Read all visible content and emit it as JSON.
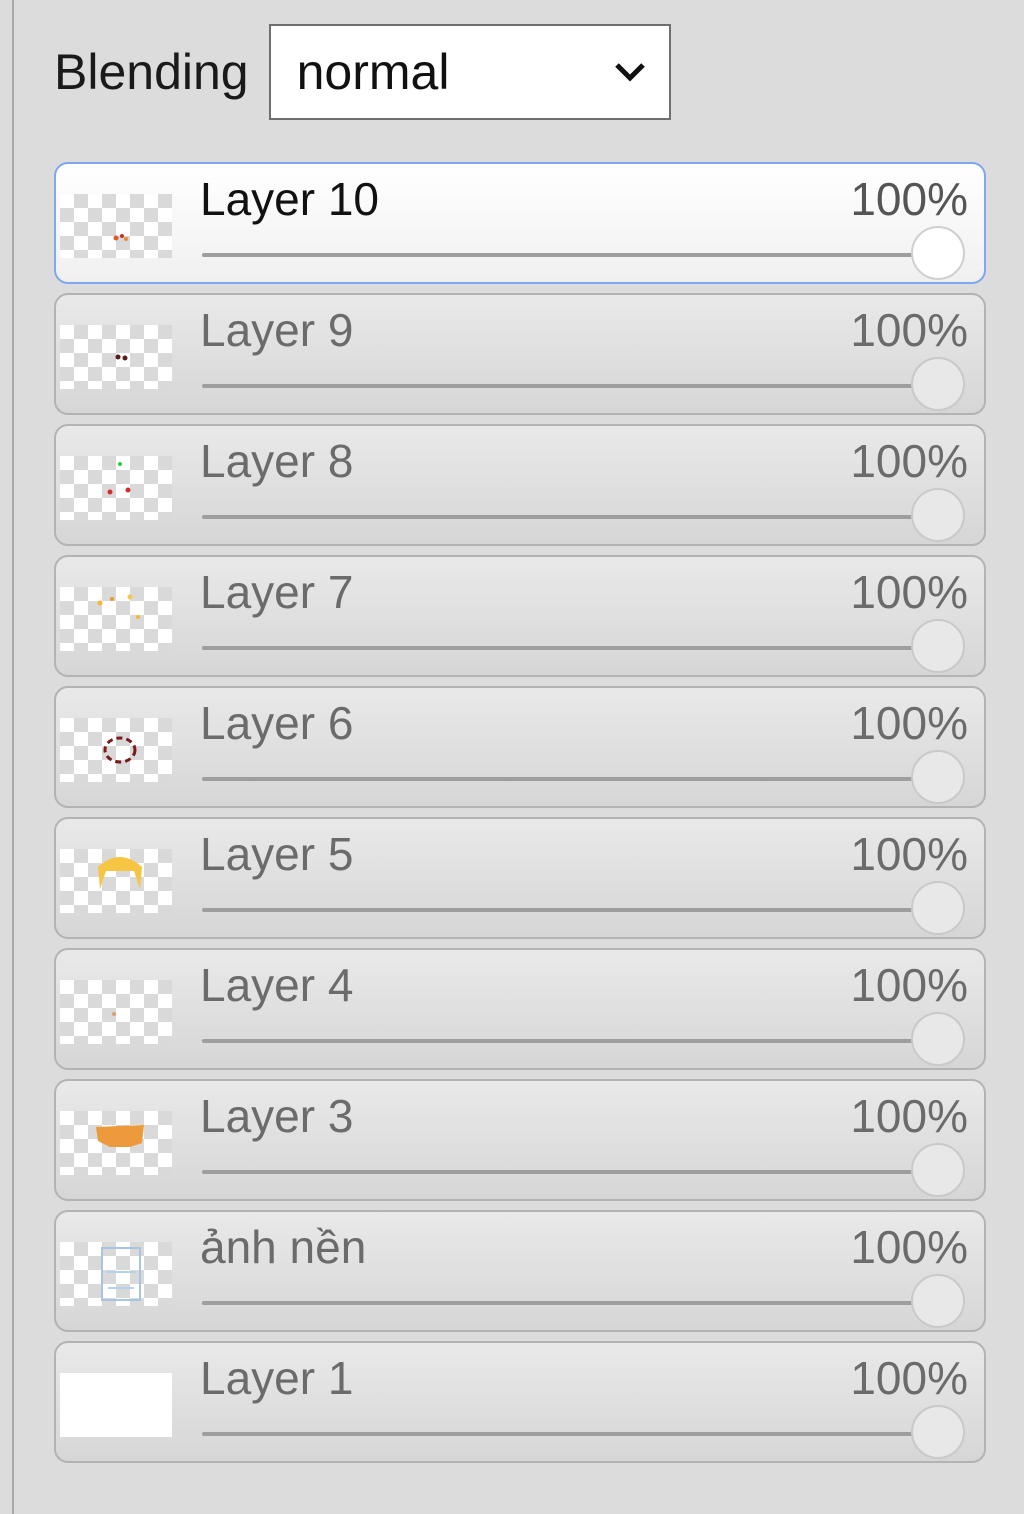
{
  "blending": {
    "label": "Blending",
    "selected": "normal"
  },
  "layers": [
    {
      "name": "Layer 10",
      "opacity_label": "100%",
      "opacity": 1.0,
      "active": true,
      "thumb": "dots-red"
    },
    {
      "name": "Layer 9",
      "opacity_label": "100%",
      "opacity": 1.0,
      "active": false,
      "thumb": "dots-dark"
    },
    {
      "name": "Layer 8",
      "opacity_label": "100%",
      "opacity": 1.0,
      "active": false,
      "thumb": "dots-red-green"
    },
    {
      "name": "Layer 7",
      "opacity_label": "100%",
      "opacity": 1.0,
      "active": false,
      "thumb": "dots-yellow"
    },
    {
      "name": "Layer 6",
      "opacity_label": "100%",
      "opacity": 1.0,
      "active": false,
      "thumb": "ring-dark-red"
    },
    {
      "name": "Layer 5",
      "opacity_label": "100%",
      "opacity": 1.0,
      "active": false,
      "thumb": "hair-yellow"
    },
    {
      "name": "Layer 4",
      "opacity_label": "100%",
      "opacity": 1.0,
      "active": false,
      "thumb": "dot-tan"
    },
    {
      "name": "Layer 3",
      "opacity_label": "100%",
      "opacity": 1.0,
      "active": false,
      "thumb": "blob-orange"
    },
    {
      "name": "ảnh nền",
      "opacity_label": "100%",
      "opacity": 1.0,
      "active": false,
      "thumb": "sketch-blue"
    },
    {
      "name": "Layer 1",
      "opacity_label": "100%",
      "opacity": 1.0,
      "active": false,
      "thumb": "solid-white"
    }
  ]
}
